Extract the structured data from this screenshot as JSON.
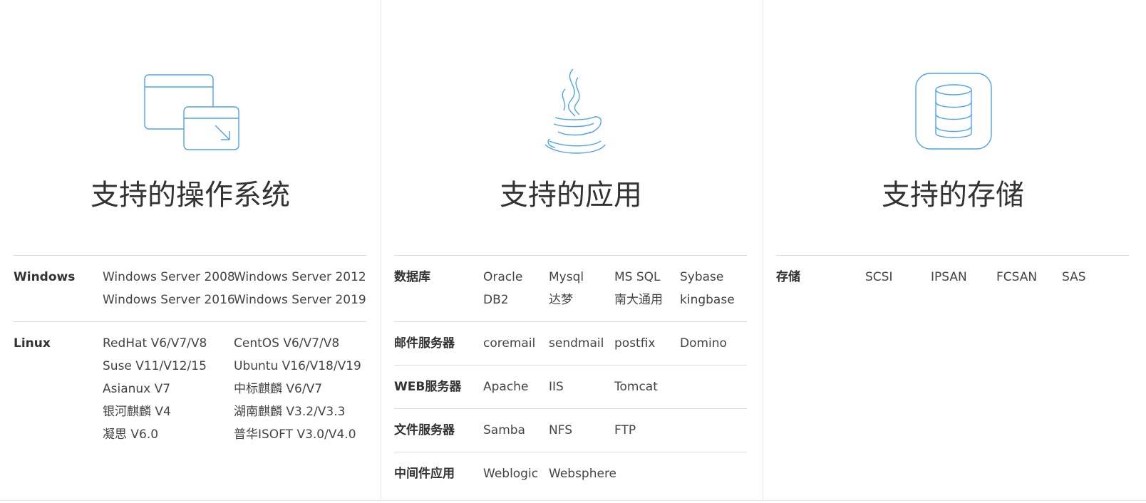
{
  "os": {
    "title": "支持的操作系统",
    "icon": "window-resize-icon",
    "rows": [
      {
        "label": "Windows",
        "items": [
          "Windows Server 2008",
          "Windows Server 2012",
          "Windows Server 2016",
          "Windows Server 2019"
        ]
      },
      {
        "label": "Linux",
        "items": [
          "RedHat V6/V7/V8",
          "CentOS V6/V7/V8",
          "Suse V11/V12/15",
          "Ubuntu V16/V18/V19",
          "Asianux V7",
          "中标麒麟 V6/V7",
          "银河麒麟 V4",
          "湖南麒麟 V3.2/V3.3",
          "凝思 V6.0",
          "普华ISOFT V3.0/V4.0"
        ]
      }
    ]
  },
  "app": {
    "title": "支持的应用",
    "icon": "java-icon",
    "rows": [
      {
        "label": "数据库",
        "items": [
          "Oracle",
          "Mysql",
          "MS SQL",
          "Sybase",
          "DB2",
          "达梦",
          "南大通用",
          "kingbase"
        ]
      },
      {
        "label": "邮件服务器",
        "items": [
          "coremail",
          "sendmail",
          "postfix",
          "Domino"
        ]
      },
      {
        "label": "WEB服务器",
        "items": [
          "Apache",
          "IIS",
          "Tomcat"
        ]
      },
      {
        "label": "文件服务器",
        "items": [
          "Samba",
          "NFS",
          "FTP"
        ]
      },
      {
        "label": "中间件应用",
        "items": [
          "Weblogic",
          "Websphere"
        ]
      }
    ]
  },
  "storage": {
    "title": "支持的存储",
    "icon": "database-icon",
    "rows": [
      {
        "label": "存储",
        "items": [
          "SCSI",
          "IPSAN",
          "FCSAN",
          "SAS"
        ]
      }
    ]
  },
  "colors": {
    "icon_stroke": "#4da3ec",
    "divider": "#dcdcdc"
  }
}
